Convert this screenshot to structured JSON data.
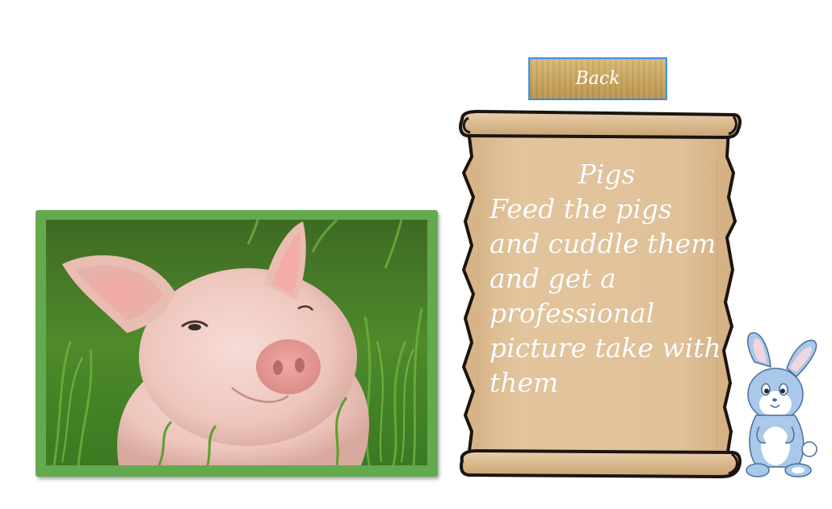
{
  "nav": {
    "back_label": "Back"
  },
  "photo": {
    "subject": "pig-photo"
  },
  "scroll": {
    "title": "Pigs",
    "description": "Feed the pigs and cuddle them and get a professional picture take with them"
  },
  "colors": {
    "frame_green": "#63a94e",
    "scroll_parchment": "#e0c199",
    "button_border": "#3b8fe8",
    "bunny_blue": "#a9c8ea"
  },
  "icons": {
    "mascot": "bunny-mascot-icon"
  }
}
